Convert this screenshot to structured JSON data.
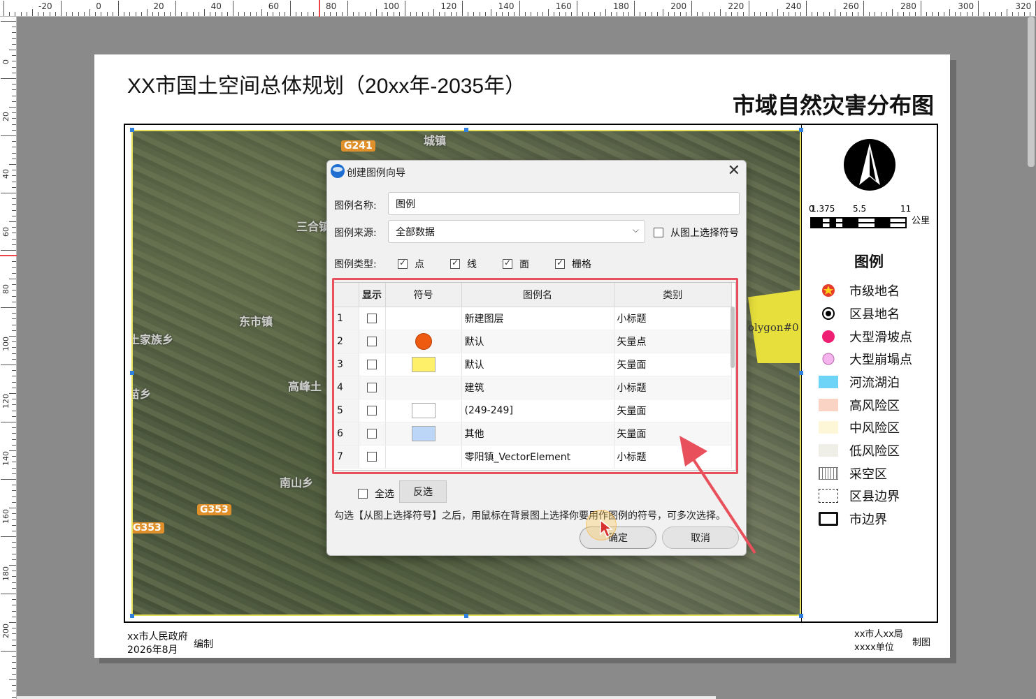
{
  "ruler": {
    "top_labels": [
      "-20",
      "0",
      "20",
      "40",
      "60",
      "80",
      "100",
      "120",
      "140",
      "160",
      "180",
      "200",
      "220",
      "240",
      "260",
      "280",
      "300",
      "320"
    ],
    "left_labels": [
      "0",
      "20",
      "40",
      "60",
      "80",
      "100",
      "120",
      "140",
      "160",
      "180",
      "200"
    ]
  },
  "map": {
    "title": "XX市国土空间总体规划（20xx年-2035年）",
    "subtitle": "市域自然灾害分布图",
    "roads": [
      "G241",
      "G353",
      "G353"
    ],
    "places": [
      "三合镇",
      "东市镇",
      "土家族乡",
      "高峰土",
      "南山乡",
      "苗乡",
      "城镇"
    ],
    "polygon_label": "olygon#0",
    "scale": {
      "labels": [
        "0",
        "1.375",
        "5.5",
        "11"
      ],
      "unit": "公里"
    },
    "legend": {
      "title": "图例",
      "items": [
        {
          "label": "市级地名",
          "symbol": "star-circle-icon"
        },
        {
          "label": "区县地名",
          "symbol": "dot-circle-icon"
        },
        {
          "label": "大型滑坡点",
          "symbol": "magenta-dot-icon"
        },
        {
          "label": "大型崩塌点",
          "symbol": "pink-dot-icon"
        },
        {
          "label": "河流湖泊",
          "symbol": "blue-fill-icon"
        },
        {
          "label": "高风险区",
          "symbol": "salmon-fill-icon"
        },
        {
          "label": "中风险区",
          "symbol": "cream-fill-icon"
        },
        {
          "label": "低风险区",
          "symbol": "grey-fill-icon"
        },
        {
          "label": "采空区",
          "symbol": "hatch-fill-icon"
        },
        {
          "label": "区县边界",
          "symbol": "dashed-border-icon"
        },
        {
          "label": "市边界",
          "symbol": "bold-border-icon"
        }
      ]
    },
    "footer": {
      "org": "xx市人民政府",
      "date": "2026年8月",
      "compile": "编制",
      "bureau": "xx市人xx局",
      "unit": "xxxx单位",
      "made": "制图"
    }
  },
  "dialog": {
    "title": "创建图例向导",
    "name_label": "图例名称:",
    "name_value": "图例",
    "source_label": "图例来源:",
    "source_value": "全部数据",
    "pick_from_map": "从图上选择符号",
    "type_label": "图例类型:",
    "types": [
      "点",
      "线",
      "面",
      "栅格"
    ],
    "columns": [
      "显示",
      "符号",
      "图例名",
      "类别"
    ],
    "rows": [
      {
        "num": "1",
        "symbol": "none",
        "name": "新建图层",
        "category": "小标题"
      },
      {
        "num": "2",
        "symbol": "circle",
        "name": "默认",
        "category": "矢量点",
        "color": "#ee5a10"
      },
      {
        "num": "3",
        "symbol": "rect",
        "name": "默认",
        "category": "矢量面",
        "color": "#fff06a"
      },
      {
        "num": "4",
        "symbol": "none",
        "name": "建筑",
        "category": "小标题"
      },
      {
        "num": "5",
        "symbol": "rect",
        "name": "(249-249]",
        "category": "矢量面",
        "color": "#ffffff"
      },
      {
        "num": "6",
        "symbol": "rect",
        "name": "其他",
        "category": "矢量面",
        "color": "#bcd6f7"
      },
      {
        "num": "7",
        "symbol": "none",
        "name": "零阳镇_VectorElement",
        "category": "小标题"
      }
    ],
    "select_all": "全选",
    "invert": "反选",
    "hint": "勾选【从图上选择符号】之后，用鼠标在背景图上选择你要用作图例的符号，可多次选择。",
    "ok": "确定",
    "cancel": "取消"
  },
  "colors": {
    "highlight": "#e8505b",
    "handle": "#2f7fe0",
    "selection_frame": "#e6e05a"
  }
}
